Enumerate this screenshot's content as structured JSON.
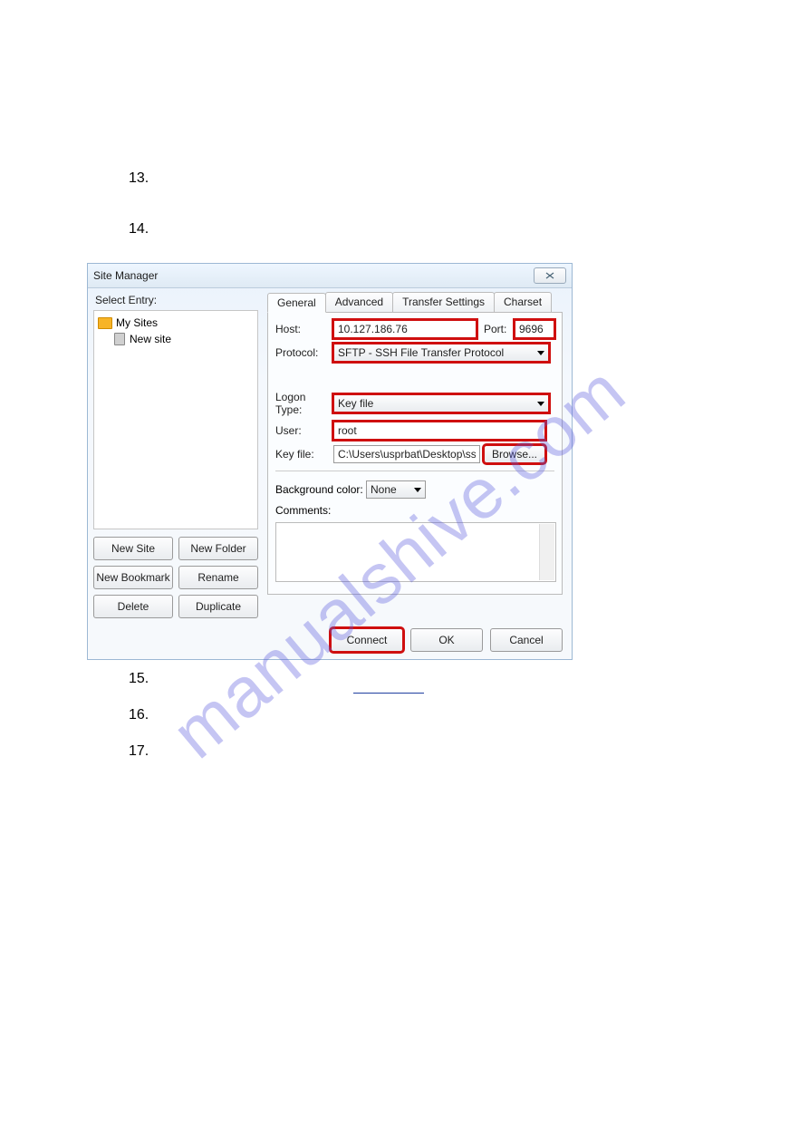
{
  "steps": {
    "s13": "13.",
    "s14": "14.",
    "s15": "15.",
    "s16": "16.",
    "s17": "17."
  },
  "watermark": "manualshive.com",
  "dialog": {
    "title": "Site Manager",
    "select_entry": "Select Entry:",
    "tree": {
      "root": "My Sites",
      "child": "New site"
    },
    "left_buttons": {
      "new_site": "New Site",
      "new_folder": "New Folder",
      "new_bookmark": "New Bookmark",
      "rename": "Rename",
      "delete": "Delete",
      "duplicate": "Duplicate"
    },
    "tabs": {
      "general": "General",
      "advanced": "Advanced",
      "transfer": "Transfer Settings",
      "charset": "Charset"
    },
    "labels": {
      "host": "Host:",
      "port": "Port:",
      "protocol": "Protocol:",
      "logon_type": "Logon Type:",
      "user": "User:",
      "key_file": "Key file:",
      "bg_color": "Background color:",
      "comments": "Comments:"
    },
    "values": {
      "host": "10.127.186.76",
      "port": "9696",
      "protocol": "SFTP - SSH File Transfer Protocol",
      "logon_type": "Key file",
      "user": "root",
      "key_file": "C:\\Users\\usprbat\\Desktop\\ssh t",
      "bg_color": "None",
      "browse": "Browse..."
    },
    "footer": {
      "connect": "Connect",
      "ok": "OK",
      "cancel": "Cancel"
    }
  }
}
